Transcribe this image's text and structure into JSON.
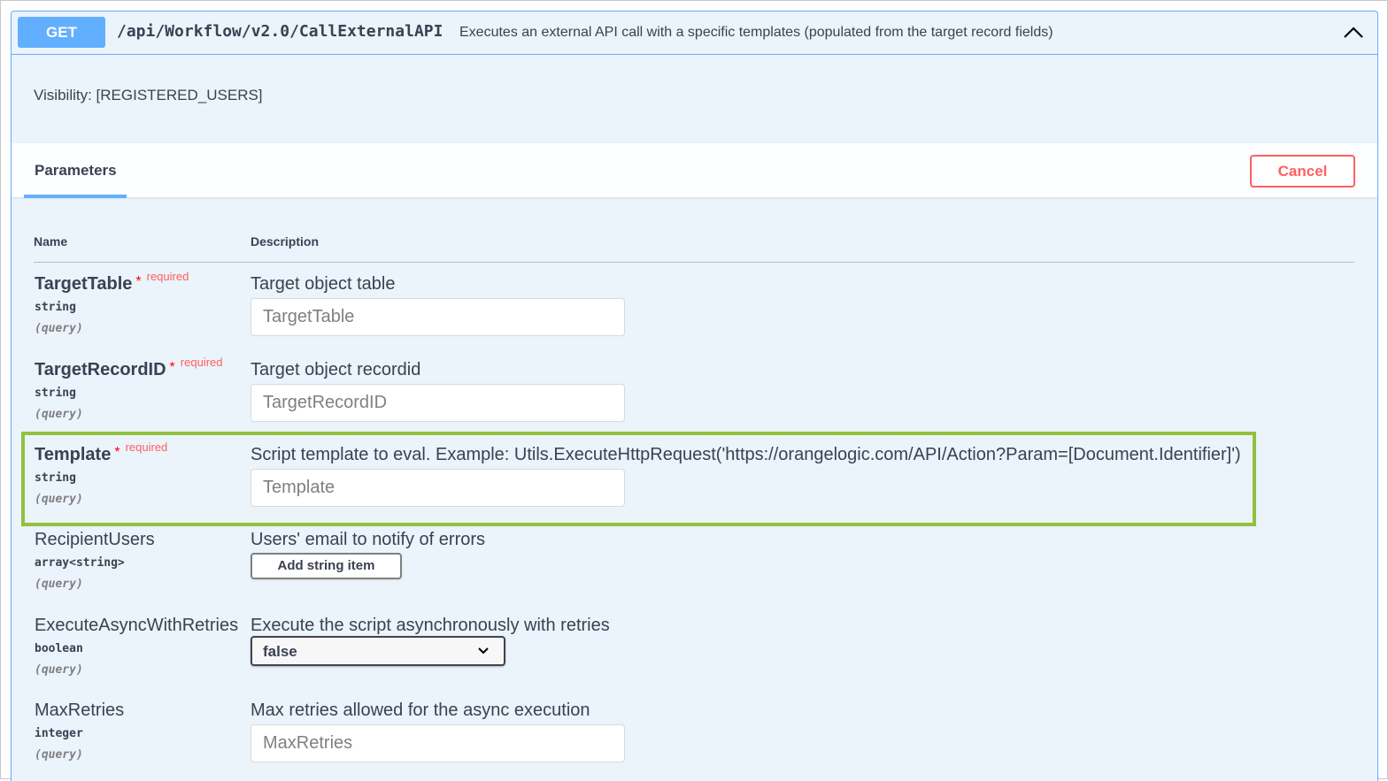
{
  "endpoint": {
    "method": "GET",
    "path": "/api/Workflow/v2.0/CallExternalAPI",
    "summary": "Executes an external API call with a specific templates (populated from the target record fields)",
    "collapse_icon": "chevron-up-icon"
  },
  "visibility": "Visibility: [REGISTERED_USERS]",
  "parameters_section": {
    "tab_label": "Parameters",
    "cancel_label": "Cancel",
    "col_name": "Name",
    "col_description": "Description"
  },
  "params": [
    {
      "name": "TargetTable",
      "star": "*",
      "required_label": "required",
      "type": "string",
      "in": "(query)",
      "description": "Target object table",
      "placeholder": "TargetTable"
    },
    {
      "name": "TargetRecordID",
      "star": "*",
      "required_label": "required",
      "type": "string",
      "in": "(query)",
      "description": "Target object recordid",
      "placeholder": "TargetRecordID"
    },
    {
      "name": "Template",
      "star": "*",
      "required_label": "required",
      "type": "string",
      "in": "(query)",
      "description": "Script template to eval. Example: Utils.ExecuteHttpRequest('https://orangelogic.com/API/Action?Param=[Document.Identifier]')",
      "placeholder": "Template"
    },
    {
      "name": "RecipientUsers",
      "type": "array<string>",
      "in": "(query)",
      "description": "Users' email to notify of errors",
      "button_label": "Add string item"
    },
    {
      "name": "ExecuteAsyncWithRetries",
      "type": "boolean",
      "in": "(query)",
      "description": "Execute the script asynchronously with retries",
      "selected_value": "false"
    },
    {
      "name": "MaxRetries",
      "type": "integer",
      "in": "(query)",
      "description": "Max retries allowed for the async execution",
      "placeholder": "MaxRetries"
    }
  ],
  "colors": {
    "get_accent": "#61affe",
    "required": "#ff6060",
    "highlight": "#92c13e"
  }
}
